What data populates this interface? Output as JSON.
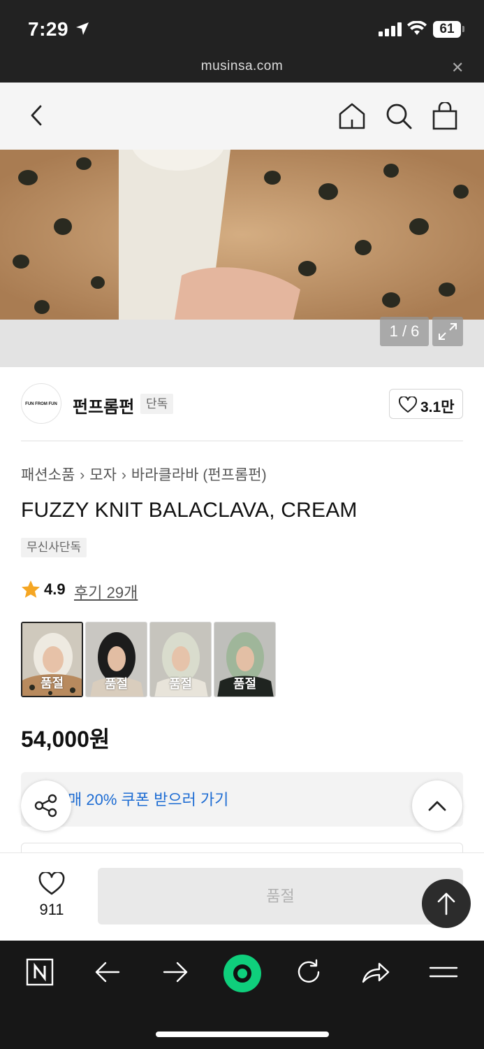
{
  "status_bar": {
    "time": "7:29",
    "battery": "61",
    "url": "musinsa.com"
  },
  "header": {
    "icons": [
      "back-icon",
      "home-icon",
      "search-icon",
      "shopping-bag-icon"
    ]
  },
  "gallery": {
    "counter": "1 / 6"
  },
  "brand": {
    "logo_text": "FUN FROM FUN",
    "name": "펀프롬펀",
    "badge": "단독",
    "likes": "3.1만"
  },
  "breadcrumb": [
    "패션소품",
    "모자",
    "바라클라바 (펀프롬펀)"
  ],
  "product": {
    "title": "FUZZY KNIT BALACLAVA, CREAM",
    "exclusive_badge": "무신사단독",
    "rating": "4.9",
    "reviews": "후기 29개",
    "price": "54,000원"
  },
  "options": [
    {
      "label": "품절",
      "selected": true
    },
    {
      "label": "품절",
      "selected": false
    },
    {
      "label": "품절",
      "selected": false
    },
    {
      "label": "품절",
      "selected": false
    }
  ],
  "coupon": {
    "text": "매 20% 쿠폰 받으러 가기",
    "accent": "#1d6cd3"
  },
  "buy_bar": {
    "wish_count": "911",
    "soldout_label": "품절"
  },
  "browser_toolbar": {
    "icons": [
      "naver-icon",
      "arrow-left-icon",
      "arrow-right-icon",
      "green-dot-icon",
      "reload-icon",
      "share-icon",
      "menu-icon"
    ]
  }
}
